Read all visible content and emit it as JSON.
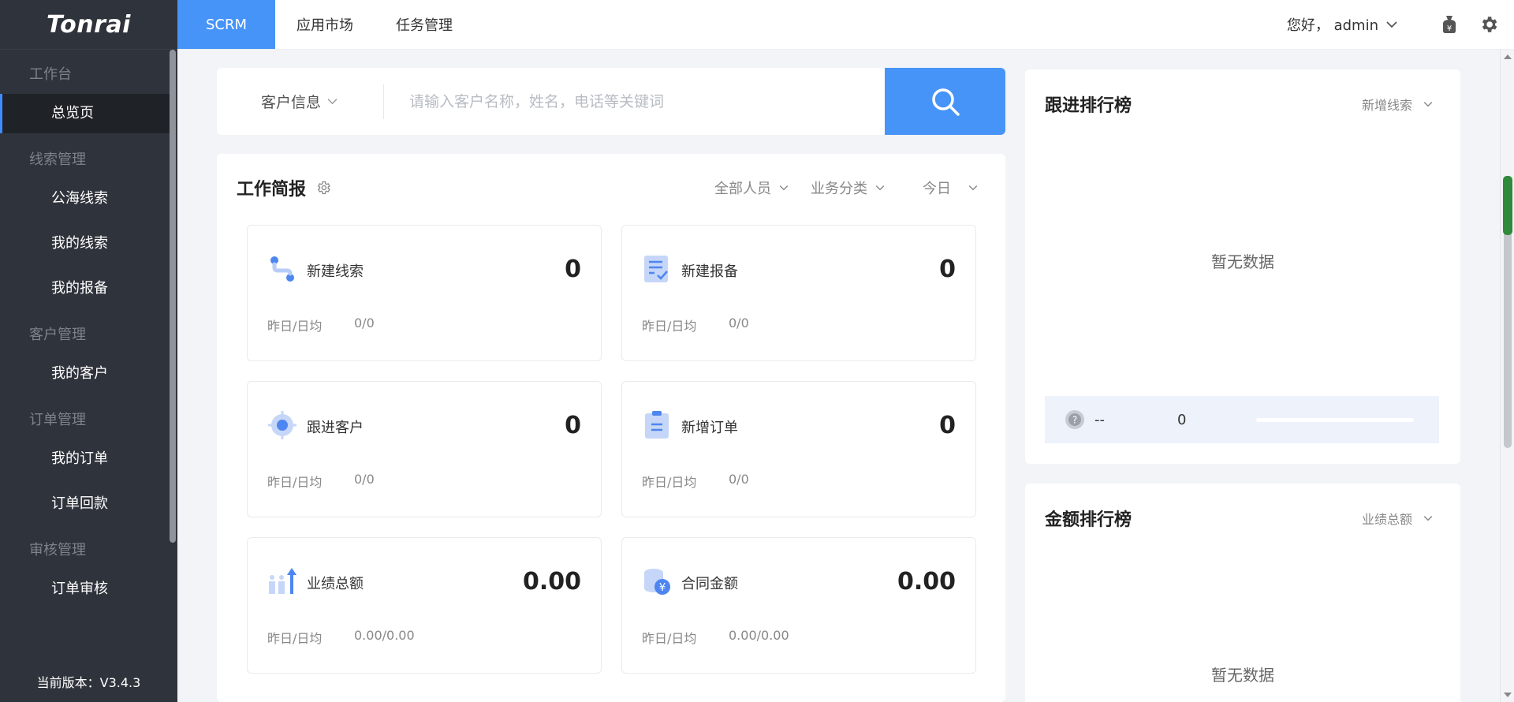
{
  "sidebar": {
    "logo": "Tonrai",
    "groups": [
      {
        "label": "工作台",
        "items": [
          "总览页"
        ]
      },
      {
        "label": "线索管理",
        "items": [
          "公海线索",
          "我的线索",
          "我的报备"
        ]
      },
      {
        "label": "客户管理",
        "items": [
          "我的客户"
        ]
      },
      {
        "label": "订单管理",
        "items": [
          "我的订单",
          "订单回款"
        ]
      },
      {
        "label": "审核管理",
        "items": [
          "订单审核"
        ]
      }
    ],
    "active_item": "总览页",
    "version": "当前版本：V3.4.3"
  },
  "topbar": {
    "tabs": [
      "SCRM",
      "应用市场",
      "任务管理"
    ],
    "active_tab": "SCRM",
    "greeting": "您好，  admin",
    "icons": [
      "money-bag-icon",
      "gear-icon"
    ]
  },
  "search": {
    "select_label": "客户信息",
    "placeholder": "请输入客户名称，姓名，电话等关键词"
  },
  "brief": {
    "title": "工作简报",
    "filters": [
      "全部人员",
      "业务分类",
      "今日"
    ],
    "cards": [
      {
        "label": "新建线索",
        "value": "0",
        "sub_label": "昨日/日均",
        "sub_value": "0/0",
        "icon": "path-icon"
      },
      {
        "label": "新建报备",
        "value": "0",
        "sub_label": "昨日/日均",
        "sub_value": "0/0",
        "icon": "checklist-icon"
      },
      {
        "label": "跟进客户",
        "value": "0",
        "sub_label": "昨日/日均",
        "sub_value": "0/0",
        "icon": "target-icon"
      },
      {
        "label": "新增订单",
        "value": "0",
        "sub_label": "昨日/日均",
        "sub_value": "0/0",
        "icon": "clipboard-icon"
      },
      {
        "label": "业绩总额",
        "value": "0.00",
        "sub_label": "昨日/日均",
        "sub_value": "0.00/0.00",
        "icon": "growth-icon"
      },
      {
        "label": "合同金额",
        "value": "0.00",
        "sub_label": "昨日/日均",
        "sub_value": "0.00/0.00",
        "icon": "coins-icon"
      }
    ]
  },
  "follow_rank": {
    "title": "跟进排行榜",
    "select": "新增线索",
    "empty": "暂无数据",
    "row": {
      "name": "--",
      "value": "0"
    }
  },
  "amount_rank": {
    "title": "金额排行榜",
    "select": "业绩总额",
    "empty": "暂无数据"
  },
  "colors": {
    "accent": "#4794f8",
    "sidebar": "#2f333b",
    "icon_blue": "#4d86f0"
  }
}
